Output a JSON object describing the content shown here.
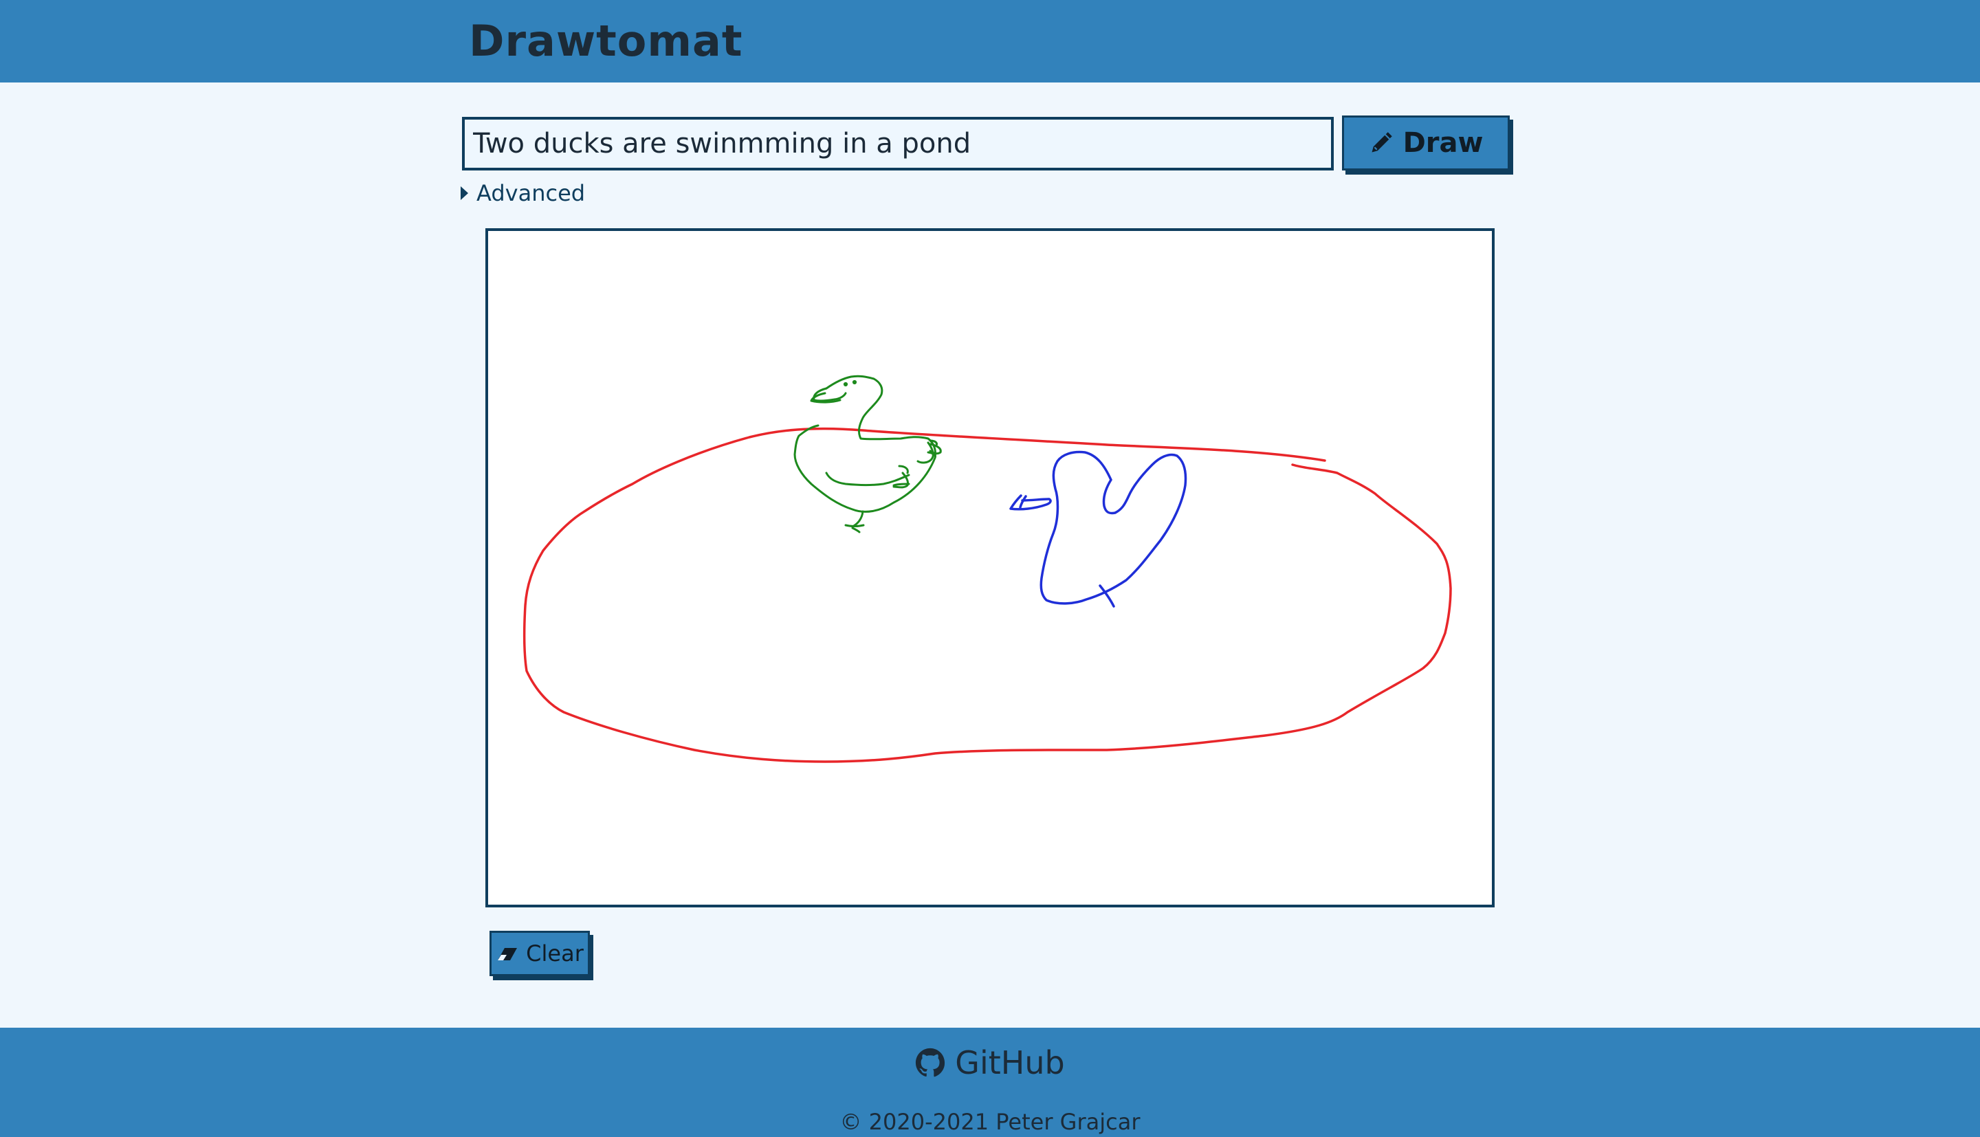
{
  "header": {
    "title": "Drawtomat"
  },
  "prompt": {
    "value": "Two ducks are swinmming in a pond",
    "placeholder": ""
  },
  "draw_button": {
    "label": "Draw",
    "icon": "pencil-icon"
  },
  "advanced": {
    "label": "Advanced",
    "icon": "caret-right-icon"
  },
  "canvas": {
    "strokes": [
      {
        "name": "pond",
        "color": "#e8262a"
      },
      {
        "name": "green-duck",
        "color": "#1d8a1d"
      },
      {
        "name": "blue-duck",
        "color": "#1f2fd8"
      }
    ]
  },
  "clear_button": {
    "label": "Clear",
    "icon": "eraser-icon"
  },
  "footer": {
    "github_label": "GitHub",
    "github_icon": "github-icon",
    "copyright": "© 2020-2021 Peter Grajcar"
  }
}
